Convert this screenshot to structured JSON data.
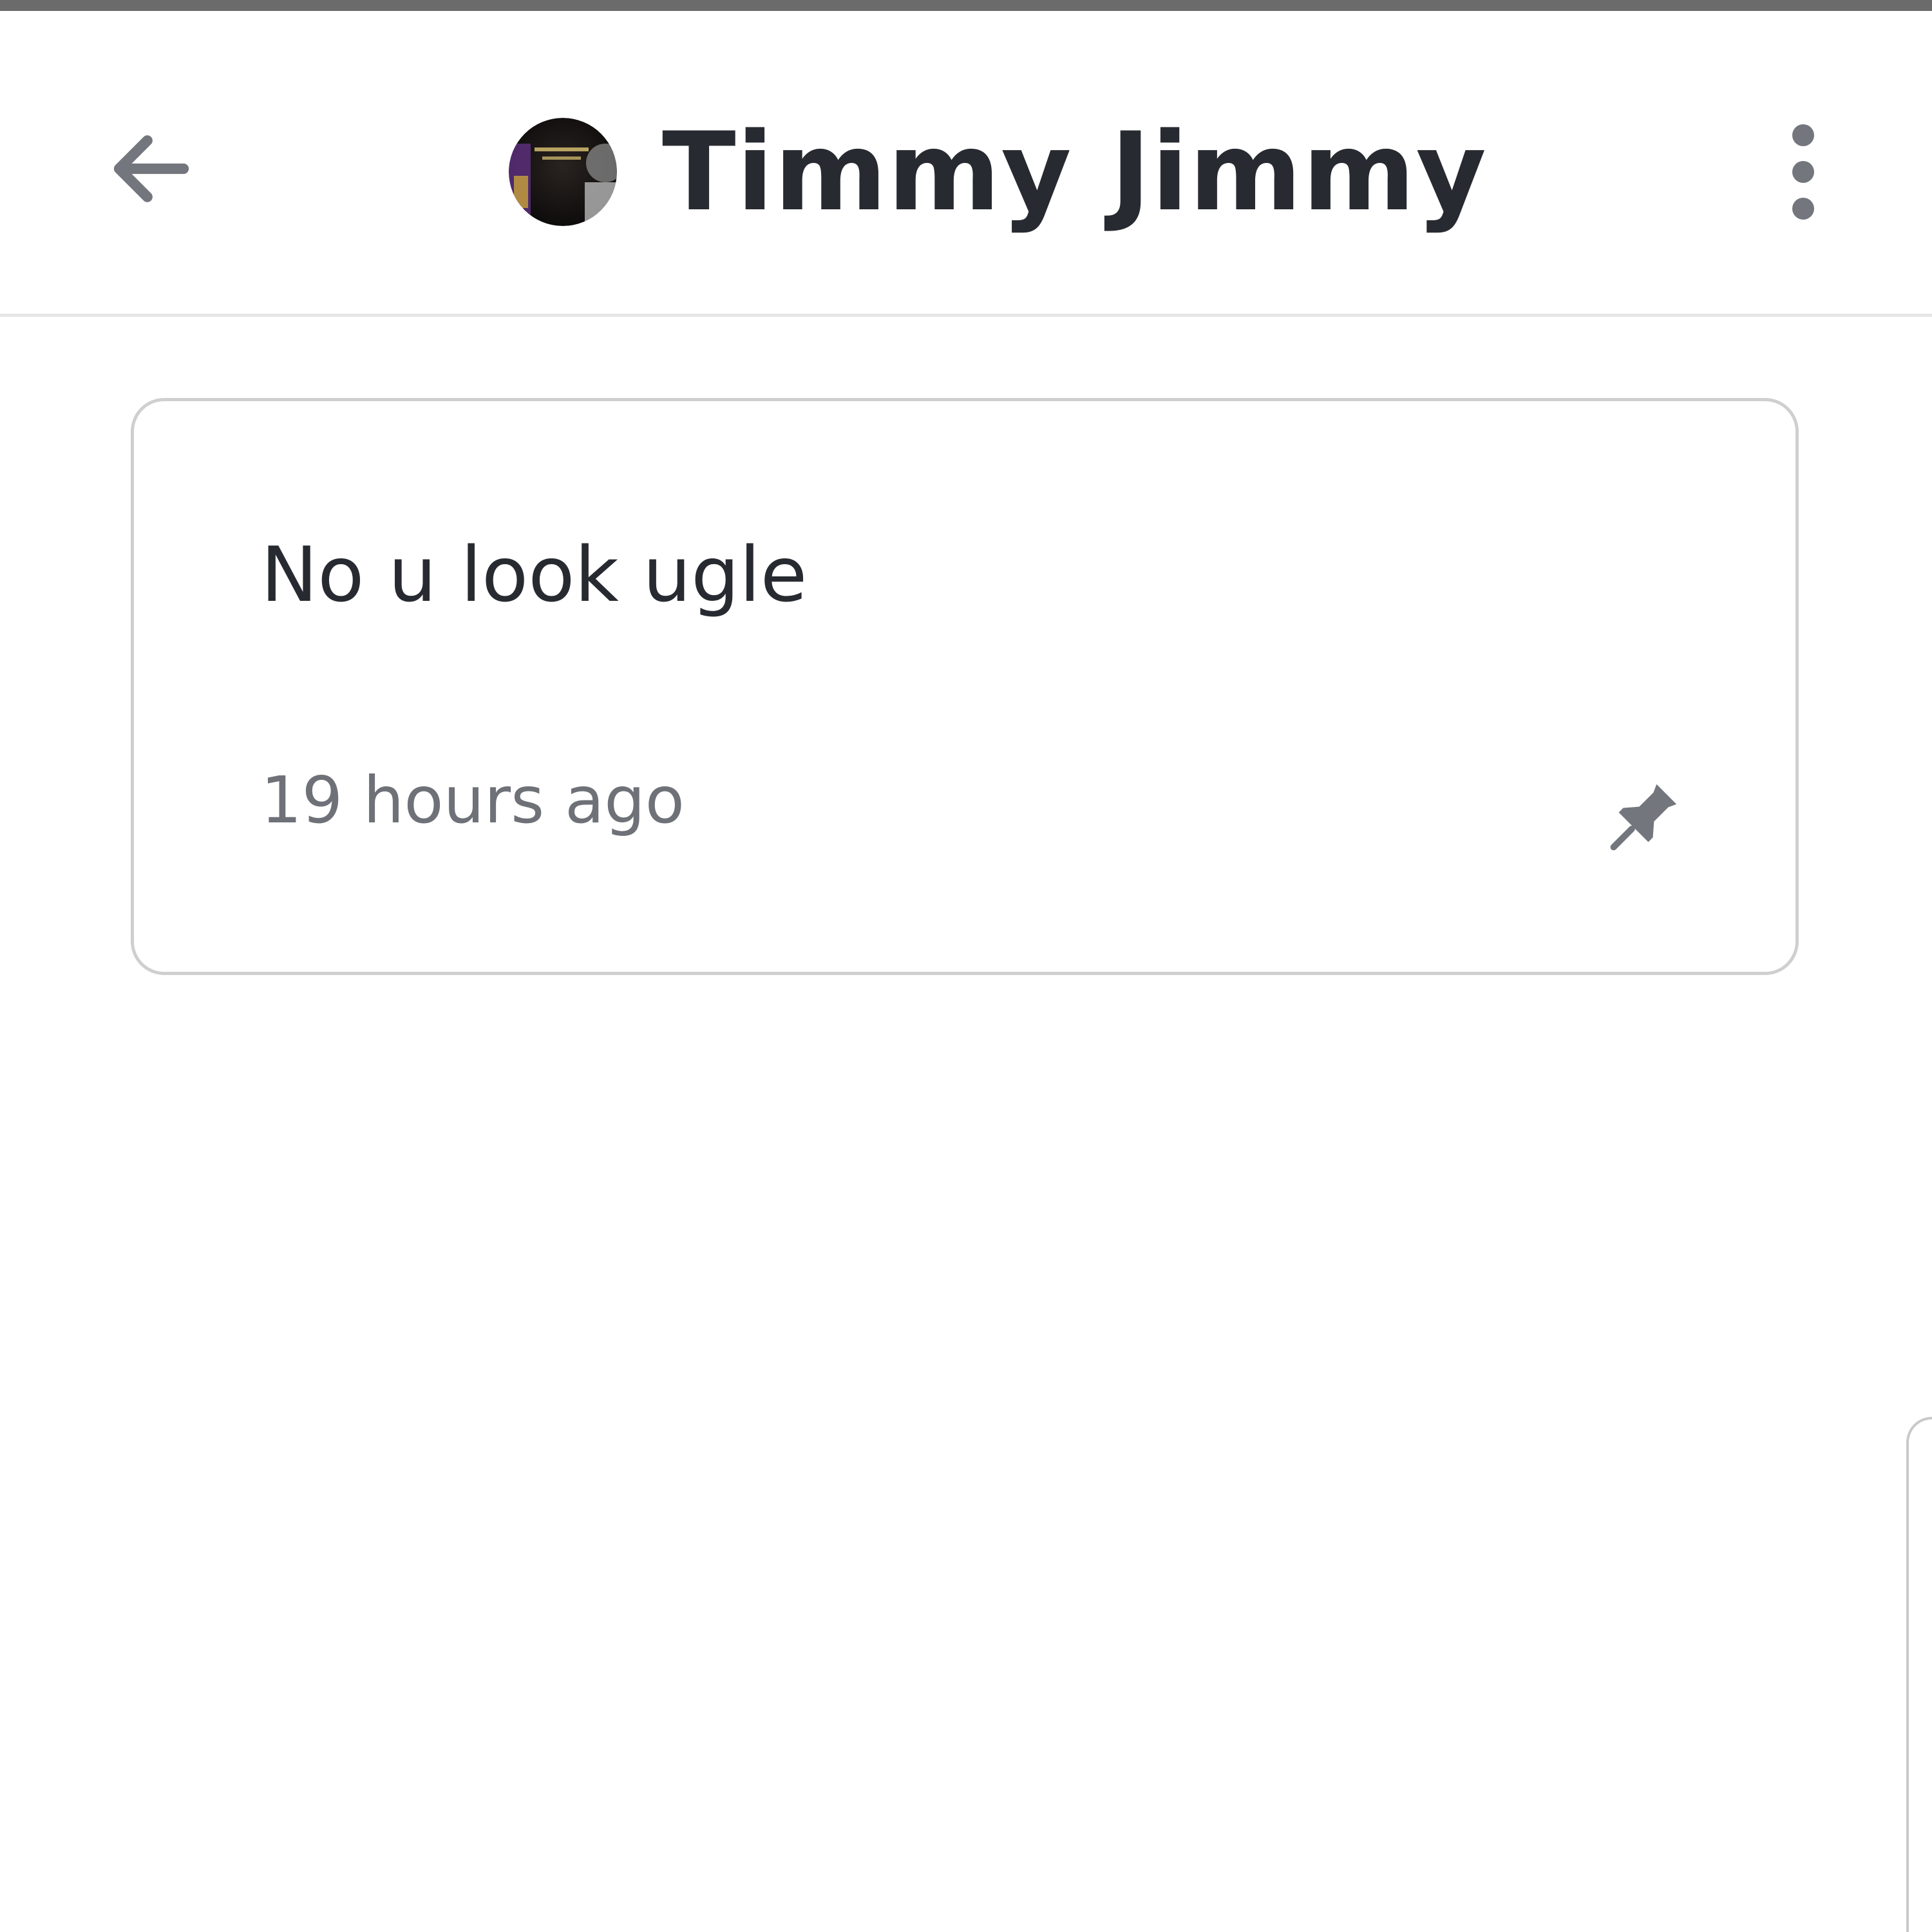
{
  "header": {
    "contact_name": "Timmy Jimmy",
    "back_icon": "arrow-left-icon",
    "more_icon": "more-vertical-icon",
    "avatar_label": "contact avatar"
  },
  "message": {
    "text": "No u look ugle",
    "timestamp": "19 hours ago",
    "pin_icon": "pin-icon"
  },
  "colors": {
    "text_primary": "#272a30",
    "text_secondary": "#6f7178",
    "icon": "#73767d",
    "border": "#cfcfcf",
    "top_strip": "#6b6b6b"
  }
}
